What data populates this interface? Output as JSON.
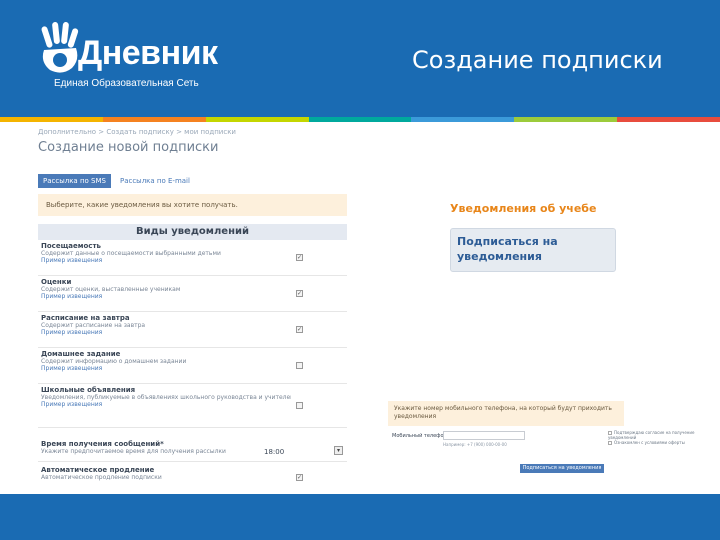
{
  "logo": {
    "word": "Дневник",
    "subtitle": "Единая Образовательная Сеть"
  },
  "slide_title": "Создание подписки",
  "stripe_colors": [
    "#f4b400",
    "#f58220",
    "#c4d600",
    "#00a99d",
    "#3b9ad9",
    "#9ccb3b",
    "#e84c3d"
  ],
  "breadcrumb": "Дополнительно > Создать подписку > мои подписки",
  "page_heading": "Создание новой подписки",
  "tabs": {
    "sms": "Рассылка по SMS",
    "email": "Рассылка по E-mail"
  },
  "notice": "Выберите, какие уведомления вы хотите получать.",
  "types": {
    "header": "Виды уведомлений",
    "items": [
      {
        "title": "Посещаемость",
        "desc": "Содержит данные о посещаемости выбранными детьми",
        "link": "Пример извещения"
      },
      {
        "title": "Оценки",
        "desc": "Содержит оценки, выставленные ученикам",
        "link": "Пример извещения"
      },
      {
        "title": "Расписание на завтра",
        "desc": "Содержит расписание на завтра",
        "link": "Пример извещения"
      },
      {
        "title": "Домашнее задание",
        "desc": "Содержит информацию о домашнем задании",
        "link": "Пример извещения"
      },
      {
        "title": "Школьные объявления",
        "desc": "Уведомления, публикуемые в объявлениях школьного руководства и учителей",
        "link": "Пример извещения"
      }
    ]
  },
  "time": {
    "title": "Время получения сообщений*",
    "desc": "Укажите предпочитаемое время для получения рассылки",
    "value": "18:00"
  },
  "auto": {
    "title": "Автоматическое продление",
    "desc": "Автоматическое продление подписки"
  },
  "edu_heading": "Уведомления об учебе",
  "subscribe_box": "Подписаться на уведомления",
  "panel2": {
    "notice": "Укажите номер мобильного телефона, на который будут приходить уведомления",
    "label": "Мобильный телефон",
    "hint": "Например: +7 (900) 000-00-00",
    "side": [
      "Подтверждаю согласие на получение уведомлений",
      "Ознакомлен с условиями оферты"
    ],
    "button": "Подписаться на уведомления"
  }
}
